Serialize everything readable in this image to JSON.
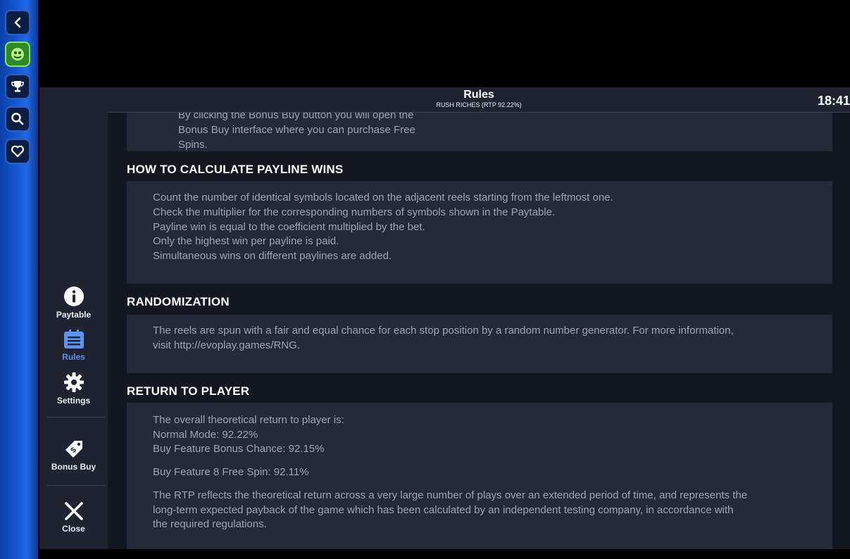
{
  "header": {
    "title": "Rules",
    "subtitle": "RUSH RICHES (RTP 92.22%)",
    "clock": "18:41"
  },
  "rail": {
    "items": [
      "back-icon",
      "game-icon",
      "trophy-icon",
      "search-icon",
      "heart-icon"
    ]
  },
  "nav": {
    "paytable": "Paytable",
    "rules": "Rules",
    "settings": "Settings",
    "bonus_buy": "Bonus Buy",
    "close": "Close"
  },
  "colors": {
    "accent": "#5c93ef",
    "panel": "#242a36",
    "rail": "#1558d4"
  },
  "sections": {
    "bonus_buy_partial": [
      "By clicking the Bonus Buy button you will open the",
      "Bonus Buy interface where you can purchase Free",
      "Spins."
    ],
    "payline": {
      "heading": "HOW TO CALCULATE PAYLINE WINS",
      "lines": [
        "Count the number of identical symbols located on the adjacent reels starting from the leftmost one.",
        "Check the multiplier for the corresponding numbers of symbols shown in the Paytable.",
        "Payline win is equal to the coefficient multiplied by the bet.",
        "Only the highest win per payline is paid.",
        "Simultaneous wins on different paylines are added."
      ]
    },
    "randomization": {
      "heading": "RANDOMIZATION",
      "lines": [
        "The reels are spun with a fair and equal chance for each stop position by a random number generator. For more information,",
        "visit http://evoplay.games/RNG."
      ]
    },
    "rtp": {
      "heading": "RETURN TO PLAYER",
      "lines": [
        "The overall theoretical return to player is:",
        "Normal Mode: 92.22%",
        "Buy Feature Bonus Chance: 92.15%",
        "Buy Feature 8 Free Spin: 92.11%",
        "The RTP reflects the theoretical return across a very large number of plays over an extended period of time, and represents the",
        "long-term expected payback of the game which has been calculated by an independent testing company, in accordance with",
        "the required regulations."
      ]
    }
  }
}
